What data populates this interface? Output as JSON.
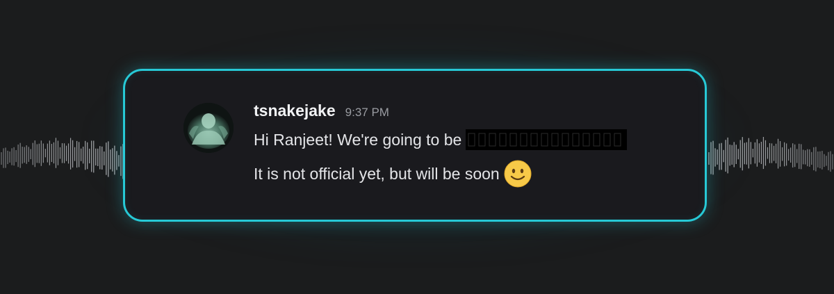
{
  "message": {
    "username": "tsnakejake",
    "timestamp": "9:37 PM",
    "line1": "Hi Ranjeet! We're going to be",
    "line2": "It is not official yet, but will be soon"
  },
  "icons": {
    "avatar": "user-avatar",
    "emoji": "slightly-smiling-face-icon",
    "redaction": "redacted-text-block"
  },
  "colors": {
    "accent_border": "#27c9d6",
    "card_background": "#1a1a1e",
    "page_background": "#1b1c1d",
    "username": "#f2f3f5",
    "timestamp": "#9a9ca2",
    "message_text": "#e4e5e8",
    "emoji_fill": "#f7c948"
  }
}
